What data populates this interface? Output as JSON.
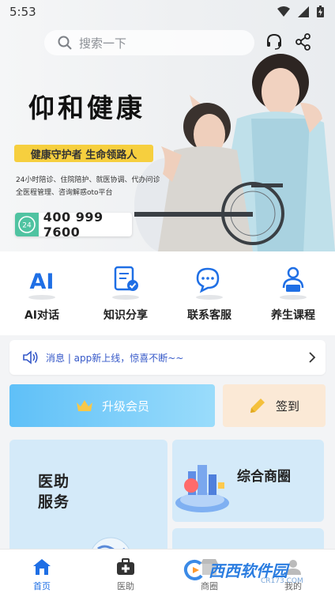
{
  "status": {
    "time": "5:53"
  },
  "search": {
    "placeholder": "搜索一下"
  },
  "banner": {
    "brand": "仰和健康",
    "slogan": "健康守护者  生命领路人",
    "services_line1": "24小时陪诊、住院陪护、就医协调、代办问诊",
    "services_line2": "全医程管理、咨询解惑oto平台",
    "phone_badge": "24",
    "phone": "400 999 7600"
  },
  "quick": [
    {
      "label": "AI对话",
      "glyph": "AI"
    },
    {
      "label": "知识分享"
    },
    {
      "label": "联系客服"
    },
    {
      "label": "养生课程"
    }
  ],
  "notice": {
    "text": "消息 | app新上线，惊喜不断~~"
  },
  "upgrade": {
    "label": "升级会员"
  },
  "signin": {
    "label": "签到"
  },
  "cards": {
    "left_title_1": "医助",
    "left_title_2": "服务",
    "right_title": "综合商圈"
  },
  "tabs": [
    {
      "label": "首页",
      "active": true
    },
    {
      "label": "医助"
    },
    {
      "label": "商圈"
    },
    {
      "label": "我的"
    }
  ],
  "watermark": {
    "text": "西西软件园",
    "domain": "CR173.COM"
  },
  "colors": {
    "accent": "#1f6fe5",
    "slogan_bg": "#f6cf3e",
    "phone_badge_bg": "#4fc3a1",
    "card_bg": "#d4eaf9"
  }
}
